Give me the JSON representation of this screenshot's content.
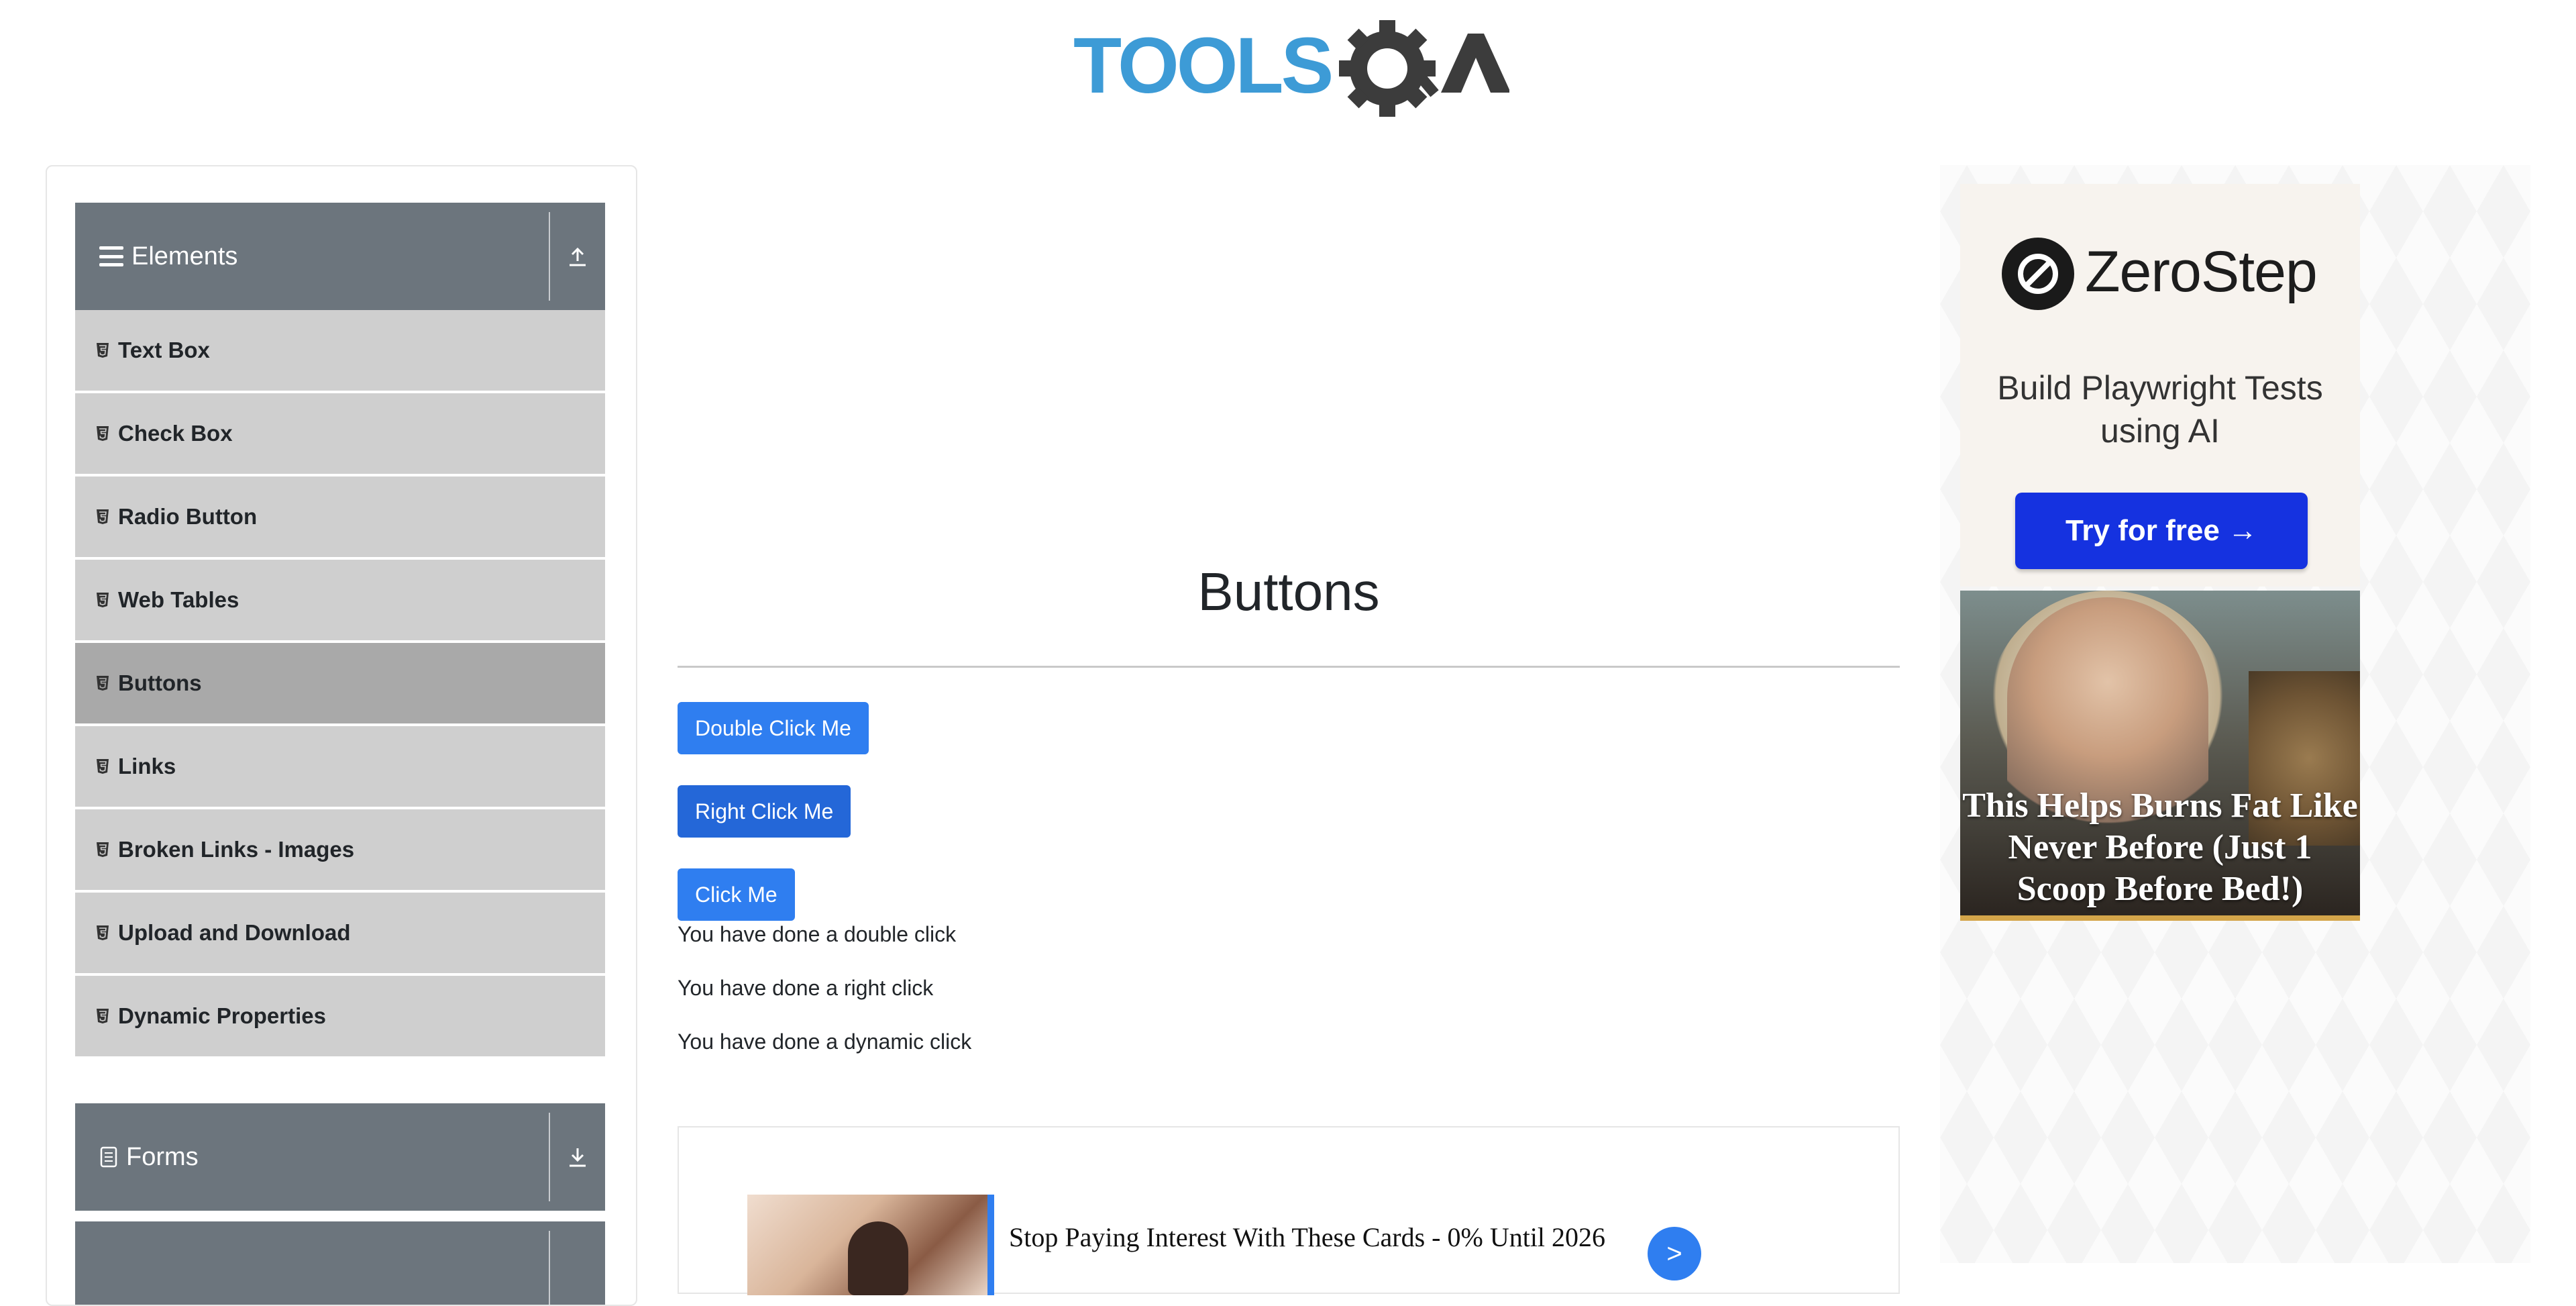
{
  "brand": {
    "logo_text": "TOOLSQA",
    "logo_blue": "#3d9bd6",
    "logo_dark": "#3c3c3c"
  },
  "sidebar": {
    "groups": [
      {
        "label": "Elements",
        "state": "expanded",
        "icon": "hamburger-icon",
        "toggle_icon": "collapse-up-icon"
      },
      {
        "label": "Forms",
        "state": "collapsed",
        "icon": "document-icon",
        "toggle_icon": "expand-down-icon"
      }
    ],
    "items": [
      {
        "label": "Text Box",
        "icon": "html5-icon"
      },
      {
        "label": "Check Box",
        "icon": "html5-icon"
      },
      {
        "label": "Radio Button",
        "icon": "html5-icon"
      },
      {
        "label": "Web Tables",
        "icon": "html5-icon"
      },
      {
        "label": "Buttons",
        "icon": "html5-icon",
        "active": true
      },
      {
        "label": "Links",
        "icon": "html5-icon"
      },
      {
        "label": "Broken Links - Images",
        "icon": "html5-icon"
      },
      {
        "label": "Upload and Download",
        "icon": "html5-icon"
      },
      {
        "label": "Dynamic Properties",
        "icon": "html5-icon"
      }
    ],
    "header_color": "#6c757d",
    "item_color": "#cfcfcf",
    "active_color": "#a9a9a9"
  },
  "main": {
    "title": "Buttons",
    "buttons": {
      "double_click": "Double Click Me",
      "right_click": "Right Click Me",
      "click": "Click Me"
    },
    "messages": {
      "double": "You have done a double click",
      "right": "You have done a right click",
      "dynamic": "You have done a dynamic click"
    },
    "button_color": "#2f7ef0"
  },
  "inline_ad": {
    "headline": "Stop Paying Interest With These Cards - 0% Until 2026",
    "arrow": ">"
  },
  "right_ad": {
    "zerostep": {
      "name": "ZeroStep",
      "tagline": "Build Playwright Tests using AI",
      "cta": "Try for free →",
      "cta_color": "#1532e0"
    },
    "fat_ad": {
      "headline": "This Helps Burns Fat Like Never Before (Just 1 Scoop Before Bed!)"
    }
  }
}
